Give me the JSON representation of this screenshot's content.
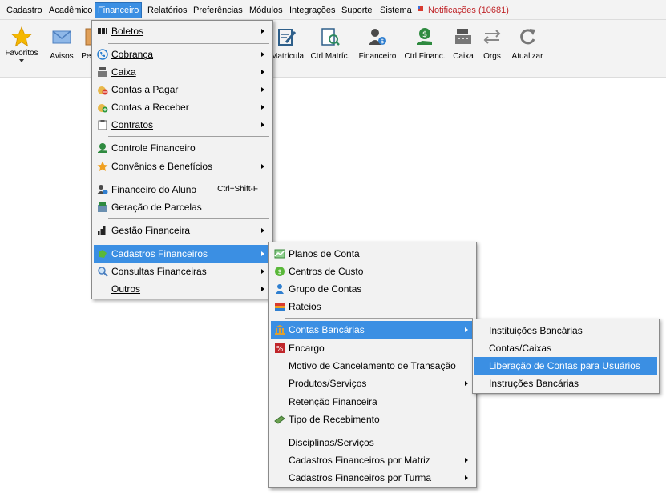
{
  "menubar": {
    "cadastro": "Cadastro",
    "academico": "Acadêmico",
    "financeiro": "Financeiro",
    "relatorios": "Relatórios",
    "preferencias": "Preferências",
    "modulos": "Módulos",
    "integracoes": "Integrações",
    "suporte": "Suporte",
    "sistema": "Sistema",
    "notificacoes": "Notificações (10681)"
  },
  "toolbar": {
    "favoritos": "Favoritos",
    "avisos": "Avisos",
    "per": "Per",
    "matricula": "Matrícula",
    "ctrl_matric": "Ctrl Matríc.",
    "financeiro": "Financeiro",
    "ctrl_financ": "Ctrl Financ.",
    "caixa": "Caixa",
    "orgs": "Orgs",
    "atualizar": "Atualizar"
  },
  "financeiro_menu": {
    "boletos": "Boletos",
    "cobranca": "Cobrança",
    "caixa": "Caixa",
    "contas_pagar": "Contas a Pagar",
    "contas_receber": "Contas a Receber",
    "contratos": "Contratos",
    "controle_financeiro": "Controle Financeiro",
    "convenios": "Convênios e Benefícios",
    "financeiro_aluno": "Financeiro do Aluno",
    "financeiro_aluno_shortcut": "Ctrl+Shift-F",
    "geracao_parcelas": "Geração de Parcelas",
    "gestao_financeira": "Gestão Financeira",
    "cadastros_financeiros": "Cadastros Financeiros",
    "consultas_financeiras": "Consultas Financeiras",
    "outros": "Outros"
  },
  "cadastros_menu": {
    "planos_conta": "Planos de Conta",
    "centros_custo": "Centros de Custo",
    "grupo_contas": "Grupo de Contas",
    "rateios": "Rateios",
    "contas_bancarias": "Contas Bancárias",
    "encargo": "Encargo",
    "motivo_cancelamento": "Motivo de Cancelamento de Transação",
    "produtos_servicos": "Produtos/Serviços",
    "retencao_financeira": "Retenção Financeira",
    "tipo_recebimento": "Tipo de Recebimento",
    "disciplinas_servicos": "Disciplinas/Serviços",
    "cad_por_matriz": "Cadastros Financeiros por Matriz",
    "cad_por_turma": "Cadastros Financeiros por Turma"
  },
  "contas_menu": {
    "instituicoes": "Instituições Bancárias",
    "contas_caixas": "Contas/Caixas",
    "liberacao": "Liberação de Contas para Usuários",
    "instrucoes": "Instruções Bancárias"
  },
  "colors": {
    "highlight": "#3b8fe3",
    "menubar_bg": "#f3f3f3",
    "menu_bg": "#f2f2f2",
    "notification": "#c0262a"
  }
}
